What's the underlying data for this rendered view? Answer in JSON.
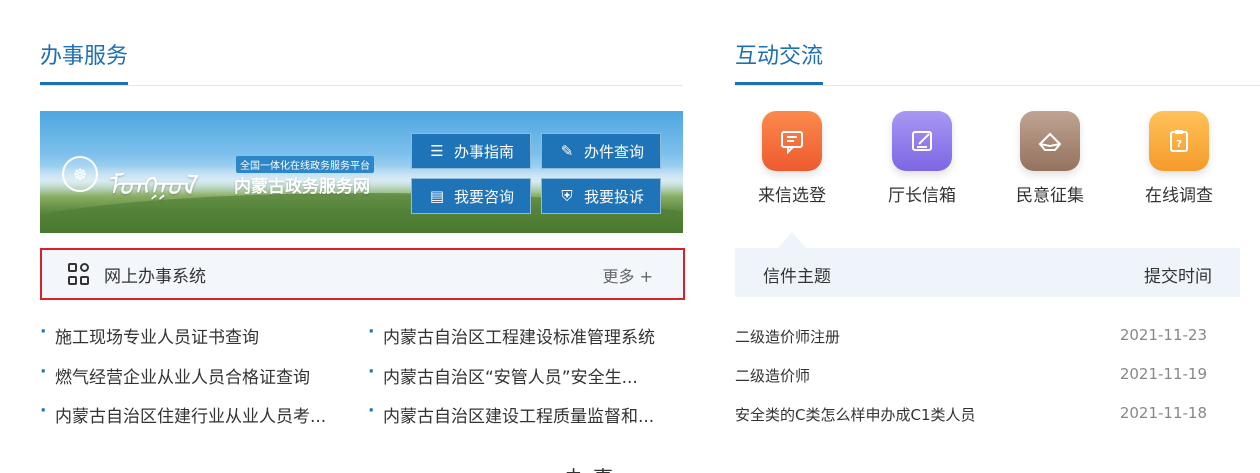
{
  "left_section": {
    "title": "办事服务"
  },
  "right_section": {
    "title": "互动交流"
  },
  "banner": {
    "emblem": "☸",
    "mongol_text": "ᠮᠣᠩᠭᠣᠯ",
    "tagline": "全国一体化在线政务服务平台",
    "site_name": "内蒙古政务服务网",
    "buttons": [
      {
        "label": "办事指南",
        "icon": "list-icon"
      },
      {
        "label": "办件查询",
        "icon": "edit-icon"
      },
      {
        "label": "我要咨询",
        "icon": "doc-icon"
      },
      {
        "label": "我要投诉",
        "icon": "shield-icon"
      }
    ]
  },
  "system_bar": {
    "label": "网上办事系统",
    "more": "更多 +"
  },
  "links": [
    "施工现场专业人员证书查询",
    "内蒙古自治区工程建设标准管理系统",
    "燃气经营企业从业人员合格证查询",
    "内蒙古自治区“安管人员”安全生...",
    "内蒙古自治区住建行业从业人员考...",
    "内蒙古自治区建设工程质量监督和..."
  ],
  "interactions": [
    {
      "label": "来信选登",
      "icon": "message-icon",
      "color": "#f2683b"
    },
    {
      "label": "厅长信箱",
      "icon": "pen-icon",
      "color": "#8f7bea"
    },
    {
      "label": "民意征集",
      "icon": "envelope-icon",
      "color": "#a98a78"
    },
    {
      "label": "在线调查",
      "icon": "clipboard-icon",
      "color": "#f7a93a"
    }
  ],
  "mail_table": {
    "header": {
      "subject": "信件主题",
      "time": "提交时间"
    },
    "rows": [
      {
        "subject": "二级造价师注册",
        "date": "2021-11-23"
      },
      {
        "subject": "二级造价师",
        "date": "2021-11-19"
      },
      {
        "subject": "安全类的C类怎么样申办成C1类人员",
        "date": "2021-11-18"
      }
    ]
  },
  "bottom_partial": "办事"
}
